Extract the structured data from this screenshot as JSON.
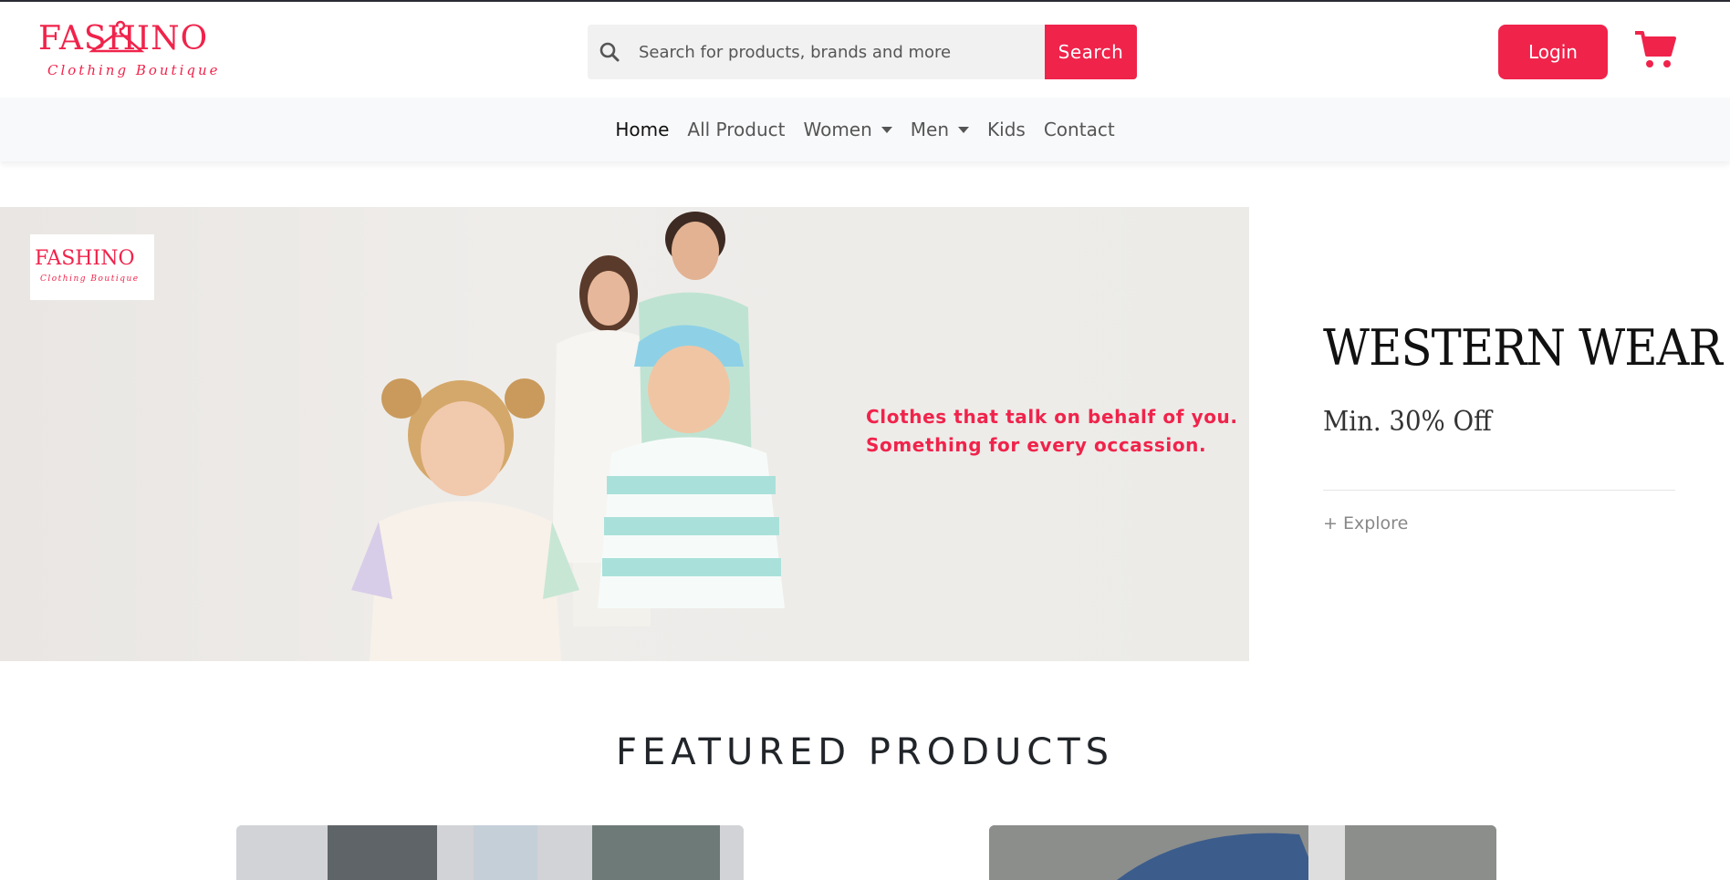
{
  "brand": {
    "logo_text": "FASHINO",
    "logo_subtitle": "Clothing Boutique",
    "accent_color": "#f0234b"
  },
  "search": {
    "placeholder": "Search for products, brands and more",
    "button_label": "Search",
    "icon": "search-icon"
  },
  "header": {
    "login_label": "Login",
    "cart_icon": "cart-icon"
  },
  "nav": {
    "items": [
      {
        "label": "Home",
        "active": true
      },
      {
        "label": "All Product"
      },
      {
        "label": "Women",
        "dropdown": true
      },
      {
        "label": "Men",
        "dropdown": true
      },
      {
        "label": "Kids"
      },
      {
        "label": "Contact"
      }
    ]
  },
  "hero": {
    "logo_text": "FASHINO",
    "logo_subtitle": "Clothing Boutique",
    "tagline_line1": "Clothes that talk on behalf of you.",
    "tagline_line2": "Something for every occassion."
  },
  "promo": {
    "title": "WESTERN WEAR",
    "subtitle": "Min. 30% Off",
    "explore_label": "+ Explore"
  },
  "featured": {
    "title": "FEATURED PRODUCTS"
  }
}
